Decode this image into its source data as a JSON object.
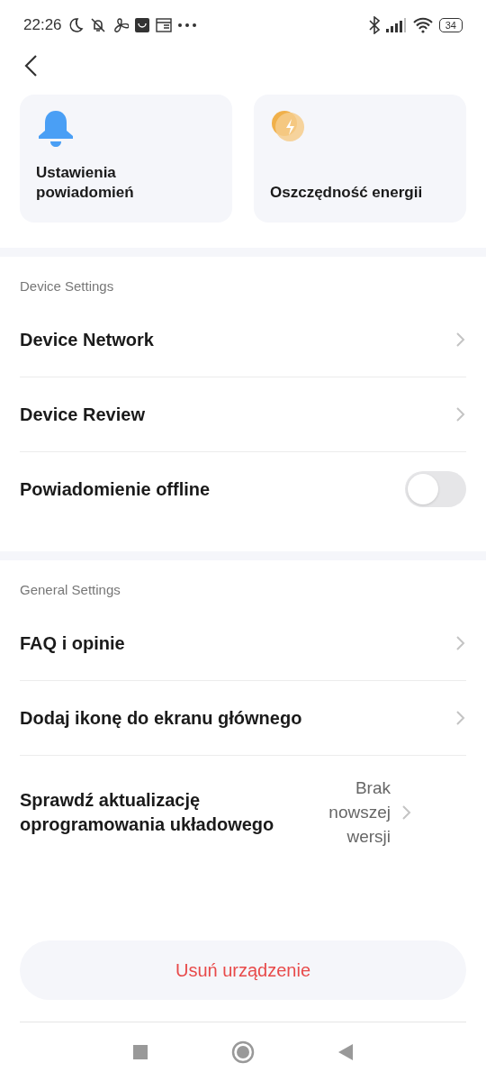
{
  "status_bar": {
    "time": "22:26",
    "battery": "34"
  },
  "cards": [
    {
      "kind": "bell",
      "label": "Ustawienia powiadomień"
    },
    {
      "kind": "energy",
      "label": "Oszczędność energii"
    }
  ],
  "sections": [
    {
      "title": "Device Settings",
      "rows": [
        {
          "kind": "link",
          "label": "Device Network"
        },
        {
          "kind": "link",
          "label": "Device Review"
        },
        {
          "kind": "toggle",
          "label": "Powiadomienie offline",
          "on": false
        }
      ]
    },
    {
      "title": "General Settings",
      "rows": [
        {
          "kind": "link",
          "label": "FAQ i opinie"
        },
        {
          "kind": "link",
          "label": "Dodaj ikonę do ekranu głównego"
        },
        {
          "kind": "link",
          "label": "Sprawdź aktualizację oprogramowania układowego",
          "value": "Brak nowszej wersji"
        }
      ]
    }
  ],
  "remove_button": "Usuń urządzenie"
}
